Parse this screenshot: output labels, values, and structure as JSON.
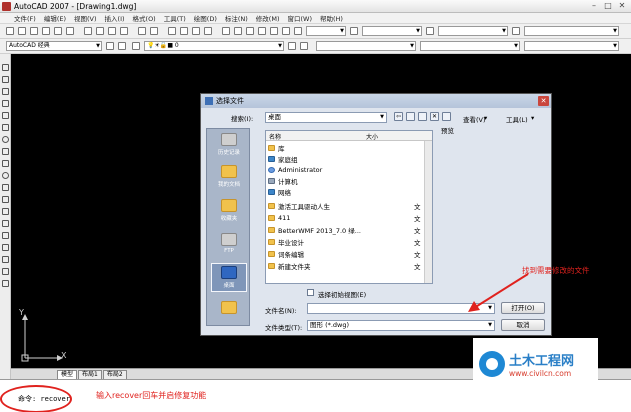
{
  "window": {
    "title": "AutoCAD 2007 - [Drawing1.dwg]"
  },
  "menu": [
    "文件(F)",
    "编辑(E)",
    "视图(V)",
    "插入(I)",
    "格式(O)",
    "工具(T)",
    "绘图(D)",
    "标注(N)",
    "修改(M)",
    "窗口(W)",
    "帮助(H)"
  ],
  "toolbar": {
    "workspace": "AutoCAD 经典",
    "layer_value": "0"
  },
  "layout_tabs": [
    "模型",
    "布局1",
    "布局2"
  ],
  "ucs": {
    "x": "X",
    "y": "Y"
  },
  "command_line": {
    "text": "命令: recover"
  },
  "annotations": {
    "command_hint": "输入recover回车并启修复功能",
    "file_hint": "找到需要修改的文件"
  },
  "dialog": {
    "title": "选择文件",
    "lookin_label": "搜索(I):",
    "lookin_value": "桌面",
    "view_label": "查看(V)",
    "tools_label": "工具(L)",
    "preview_label": "预览",
    "places": [
      {
        "label": "历史记录",
        "selected": false
      },
      {
        "label": "我的文档",
        "selected": false
      },
      {
        "label": "收藏夹",
        "selected": false
      },
      {
        "label": "FTP",
        "selected": false
      },
      {
        "label": "桌面",
        "selected": true
      },
      {
        "label": "",
        "selected": false
      }
    ],
    "columns": {
      "name": "名称",
      "size": "大小"
    },
    "files": [
      {
        "name": "库",
        "type": "",
        "icon": "folder"
      },
      {
        "name": "家庭组",
        "type": "",
        "icon": "network"
      },
      {
        "name": "Administrator",
        "type": "",
        "icon": "user"
      },
      {
        "name": "计算机",
        "type": "",
        "icon": "computer"
      },
      {
        "name": "网络",
        "type": "",
        "icon": "network"
      },
      {
        "name": "激活工具驱动人生",
        "type": "文",
        "icon": "folder"
      },
      {
        "name": "411",
        "type": "文",
        "icon": "folder"
      },
      {
        "name": "BetterWMF 2013_7.0 绿...",
        "type": "文",
        "icon": "folder"
      },
      {
        "name": "毕业设计",
        "type": "文",
        "icon": "folder"
      },
      {
        "name": "词条编辑",
        "type": "文",
        "icon": "folder"
      },
      {
        "name": "新建文件夹",
        "type": "文",
        "icon": "folder"
      }
    ],
    "initial_view_label": "选择初始视图(E)",
    "filename_label": "文件名(N):",
    "filename_value": "",
    "filetype_label": "文件类型(T):",
    "filetype_value": "图形 (*.dwg)",
    "open_button": "打开(O)",
    "cancel_button": "取消"
  },
  "watermark": {
    "title": "土木工程网",
    "url": "www.civilcn.com"
  },
  "colors": {
    "canvas": "#000000",
    "annotation": "#e0221e",
    "dialog_bg": "#dfe5ee",
    "watermark_blue": "#2a7fc7"
  }
}
